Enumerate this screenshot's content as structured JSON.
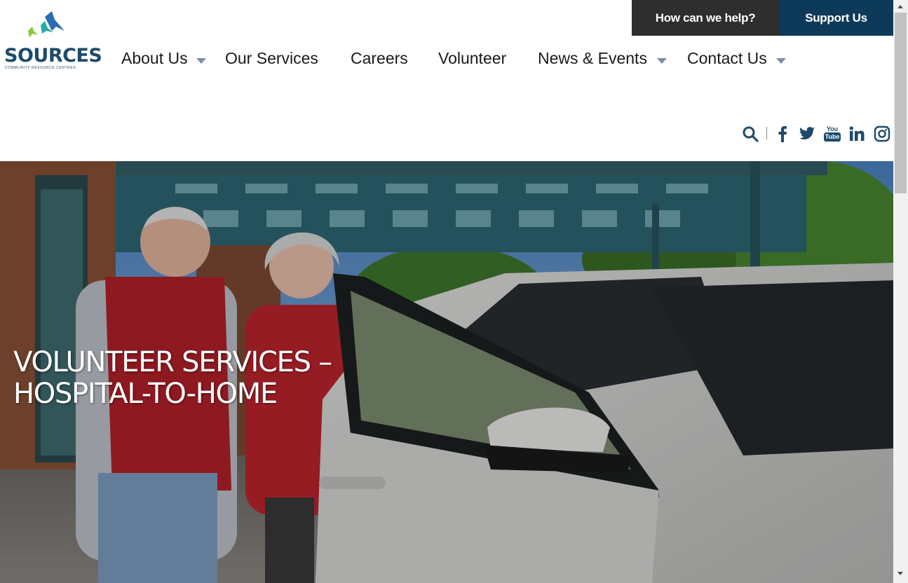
{
  "logo": {
    "wordmark": "SOURCES",
    "tagline": "COMMUNITY RESOURCE CENTRES"
  },
  "top_buttons": {
    "help": "How can we help?",
    "support": "Support Us"
  },
  "nav": {
    "items": [
      {
        "label": "About Us",
        "has_dropdown": true
      },
      {
        "label": "Our Services",
        "has_dropdown": false
      },
      {
        "label": "Careers",
        "has_dropdown": false
      },
      {
        "label": "Volunteer",
        "has_dropdown": false
      },
      {
        "label": "News & Events",
        "has_dropdown": true
      },
      {
        "label": "Contact Us",
        "has_dropdown": true
      }
    ]
  },
  "social": {
    "icons": [
      "search-icon",
      "facebook-icon",
      "twitter-icon",
      "youtube-icon",
      "linkedin-icon",
      "instagram-icon"
    ],
    "youtube_top": "You",
    "youtube_bottom": "Tube"
  },
  "hero": {
    "title_line1": "VOLUNTEER SERVICES –",
    "title_line2": "HOSPITAL-TO-HOME"
  },
  "colors": {
    "brand_navy": "#0e3a5a",
    "help_dark": "#2e2e2e",
    "icon_navy": "#1d4a6b",
    "caret": "#7a8ea6"
  }
}
